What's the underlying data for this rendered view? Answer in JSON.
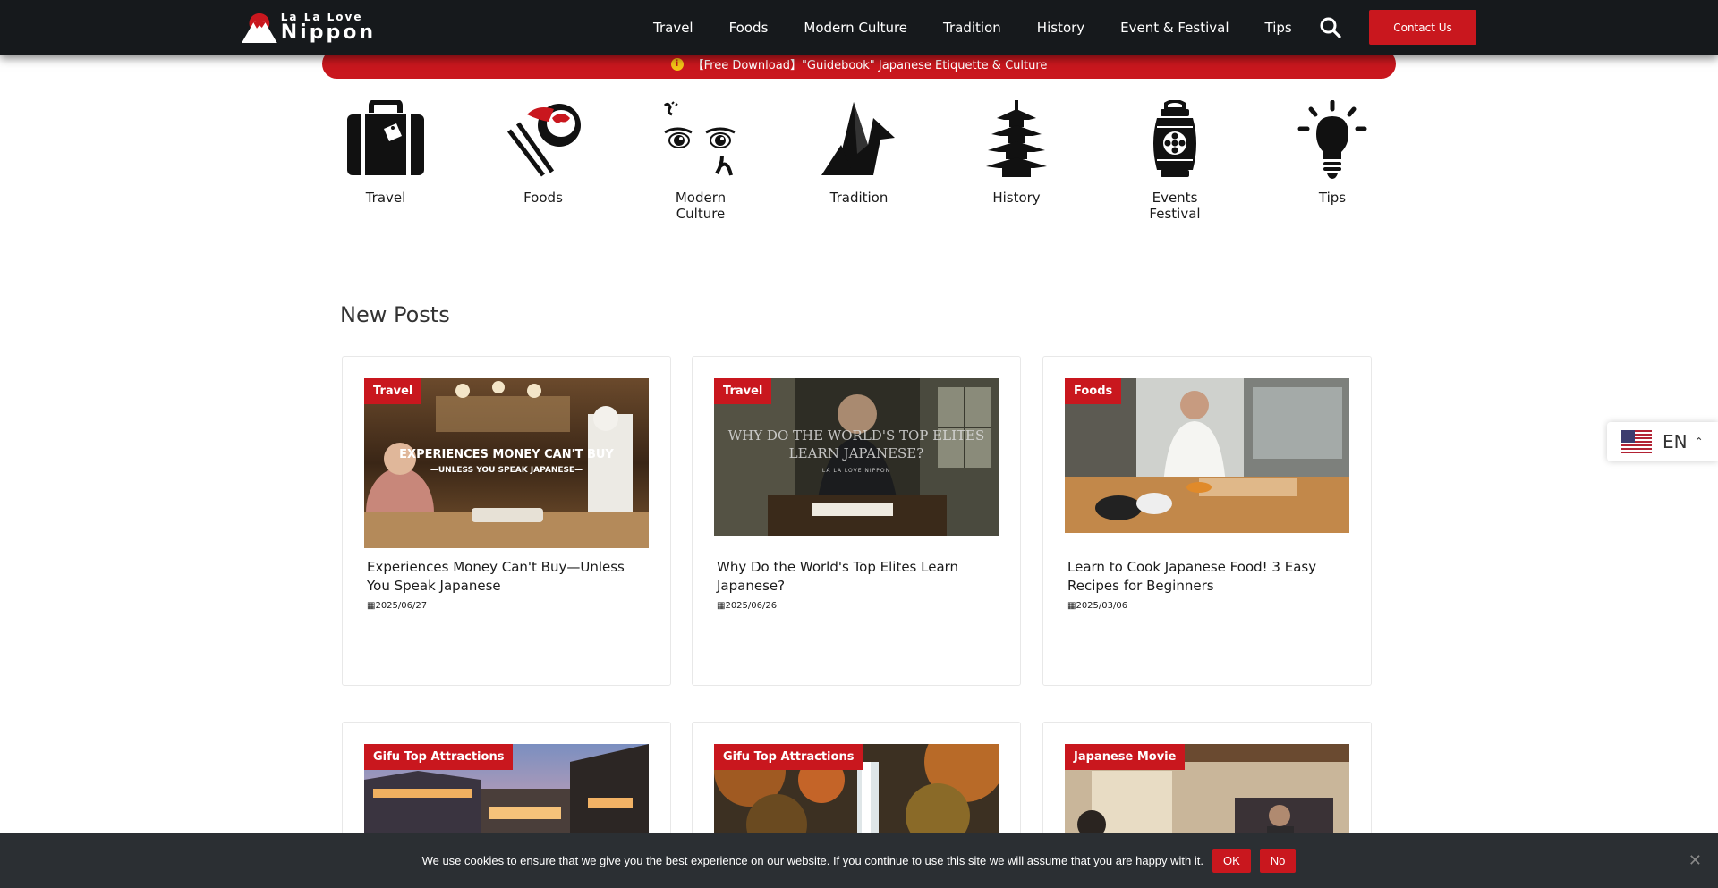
{
  "header": {
    "logo_small": "La La Love",
    "logo_big": "Nippon",
    "nav": [
      "Travel",
      "Foods",
      "Modern Culture",
      "Tradition",
      "History",
      "Event & Festival",
      "Tips"
    ],
    "contact_label": "Contact Us"
  },
  "banner": {
    "icon": "info-icon",
    "text": "【Free Download】\"Guidebook\" Japanese Etiquette & Culture"
  },
  "categories": [
    {
      "label": "Travel",
      "icon": "suitcase-icon"
    },
    {
      "label": "Foods",
      "icon": "sushi-chopsticks-icon"
    },
    {
      "label": "Modern Culture",
      "icon": "anime-eyes-icon"
    },
    {
      "label": "Tradition",
      "icon": "paper-crane-icon"
    },
    {
      "label": "History",
      "icon": "pagoda-icon"
    },
    {
      "label": "Events Festival",
      "icon": "lantern-icon"
    },
    {
      "label": "Tips",
      "icon": "lightbulb-icon"
    }
  ],
  "new_posts": {
    "title": "New Posts",
    "cards": [
      {
        "tag": "Travel",
        "title": "Experiences Money Can't Buy—Unless You Speak Japanese",
        "date": "2025/06/27",
        "overlay": "EXPERIENCES MONEY CAN'T BUY",
        "overlay_sub": "—UNLESS YOU SPEAK JAPANESE—"
      },
      {
        "tag": "Travel",
        "title": "Why Do the World's Top Elites Learn Japanese?",
        "date": "2025/06/26",
        "overlay": "WHY DO THE WORLD'S TOP ELITES LEARN JAPANESE?",
        "overlay_sub": "LA LA LOVE NIPPON"
      },
      {
        "tag": "Foods",
        "title": "Learn to Cook Japanese Food! 3 Easy Recipes for Beginners",
        "date": "2025/03/06"
      },
      {
        "tag": "Gifu Top Attractions"
      },
      {
        "tag": "Gifu Top Attractions"
      },
      {
        "tag": "Japanese Movie"
      }
    ]
  },
  "language": {
    "code": "EN"
  },
  "cookie": {
    "message": "We use cookies to ensure that we give you the best experience on our website. If you continue to use this site we will assume that you are happy with it.",
    "ok": "OK",
    "no": "No"
  },
  "colors": {
    "accent": "#c9171e",
    "header_bg": "#16191c",
    "cookie_bg": "#2b2f33"
  }
}
